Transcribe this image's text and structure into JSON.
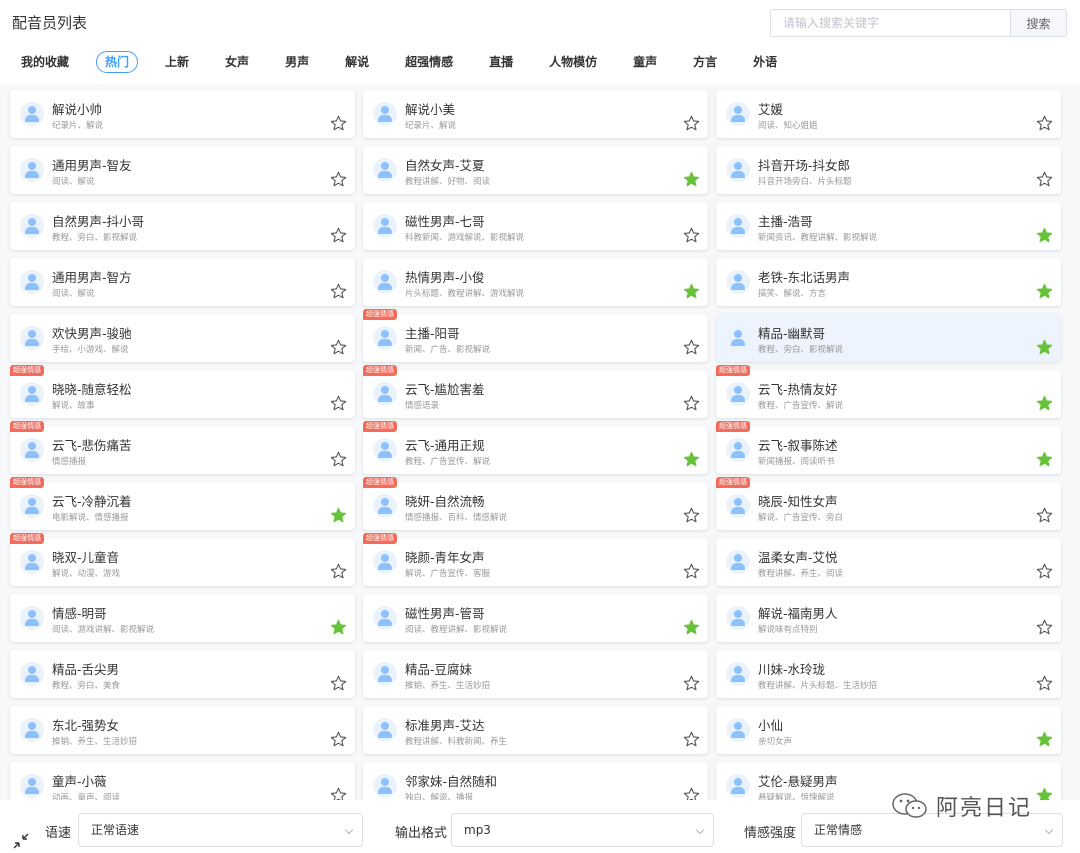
{
  "header": {
    "title": "配音员列表",
    "search_placeholder": "请输入搜索关键字",
    "search_button": "搜索"
  },
  "tabs": [
    {
      "label": "我的收藏",
      "active": false
    },
    {
      "label": "热门",
      "active": true
    },
    {
      "label": "上新",
      "active": false
    },
    {
      "label": "女声",
      "active": false
    },
    {
      "label": "男声",
      "active": false
    },
    {
      "label": "解说",
      "active": false
    },
    {
      "label": "超强情感",
      "active": false
    },
    {
      "label": "直播",
      "active": false
    },
    {
      "label": "人物模仿",
      "active": false
    },
    {
      "label": "童声",
      "active": false
    },
    {
      "label": "方言",
      "active": false
    },
    {
      "label": "外语",
      "active": false
    }
  ],
  "badge_text": "超强情感",
  "voices": [
    {
      "name": "解说小帅",
      "tags": "纪录片、解说",
      "favorite": false,
      "badge": false
    },
    {
      "name": "解说小美",
      "tags": "纪录片、解说",
      "favorite": false,
      "badge": false
    },
    {
      "name": "艾媛",
      "tags": "阅读、知心姐姐",
      "favorite": false,
      "badge": false
    },
    {
      "name": "通用男声-智友",
      "tags": "阅读、解说",
      "favorite": false,
      "badge": false
    },
    {
      "name": "自然女声-艾夏",
      "tags": "教程讲解、好物、阅读",
      "favorite": true,
      "badge": false
    },
    {
      "name": "抖音开场-抖女郎",
      "tags": "抖音开场旁白、片头标题",
      "favorite": false,
      "badge": false
    },
    {
      "name": "自然男声-抖小哥",
      "tags": "教程、旁白、影视解说",
      "favorite": false,
      "badge": false
    },
    {
      "name": "磁性男声-七哥",
      "tags": "科教新闻、游戏解说、影视解说",
      "favorite": false,
      "badge": false
    },
    {
      "name": "主播-浩哥",
      "tags": "新闻资讯、教程讲解、影视解说",
      "favorite": true,
      "badge": false
    },
    {
      "name": "通用男声-智方",
      "tags": "阅读、解说",
      "favorite": false,
      "badge": false
    },
    {
      "name": "热情男声-小俊",
      "tags": "片头标题、教程讲解、游戏解说",
      "favorite": true,
      "badge": false
    },
    {
      "name": "老铁-东北话男声",
      "tags": "搞笑、解说、方言",
      "favorite": true,
      "badge": false
    },
    {
      "name": "欢快男声-骏驰",
      "tags": "手绘、小游戏、解说",
      "favorite": false,
      "badge": false
    },
    {
      "name": "主播-阳哥",
      "tags": "新闻、广告、影视解说",
      "favorite": false,
      "badge": true
    },
    {
      "name": "精品-幽默哥",
      "tags": "教程、旁白、影视解说",
      "favorite": true,
      "badge": false,
      "selected": true
    },
    {
      "name": "晓晓-随意轻松",
      "tags": "解说、故事",
      "favorite": false,
      "badge": true
    },
    {
      "name": "云飞-尴尬害羞",
      "tags": "情感语录",
      "favorite": false,
      "badge": true
    },
    {
      "name": "云飞-热情友好",
      "tags": "教程、广告宣传、解说",
      "favorite": true,
      "badge": true
    },
    {
      "name": "云飞-悲伤痛苦",
      "tags": "情感播报",
      "favorite": false,
      "badge": true
    },
    {
      "name": "云飞-通用正规",
      "tags": "教程、广告宣传、解说",
      "favorite": true,
      "badge": true
    },
    {
      "name": "云飞-叙事陈述",
      "tags": "新闻播报、阅读听书",
      "favorite": true,
      "badge": true
    },
    {
      "name": "云飞-冷静沉着",
      "tags": "电影解说、情感播报",
      "favorite": true,
      "badge": true
    },
    {
      "name": "晓妍-自然流畅",
      "tags": "情感播报、百科、情感解说",
      "favorite": false,
      "badge": true
    },
    {
      "name": "晓辰-知性女声",
      "tags": "解说、广告宣传、旁白",
      "favorite": false,
      "badge": true
    },
    {
      "name": "晓双-儿童音",
      "tags": "解说、动漫、游戏",
      "favorite": false,
      "badge": true
    },
    {
      "name": "晓颜-青年女声",
      "tags": "解说、广告宣传、客服",
      "favorite": false,
      "badge": true
    },
    {
      "name": "温柔女声-艾悦",
      "tags": "教程讲解、养生、阅读",
      "favorite": false,
      "badge": false
    },
    {
      "name": "情感-明哥",
      "tags": "阅读、游戏讲解、影视解说",
      "favorite": true,
      "badge": false
    },
    {
      "name": "磁性男声-管哥",
      "tags": "阅读、教程讲解、影视解说",
      "favorite": true,
      "badge": false
    },
    {
      "name": "解说-福南男人",
      "tags": "解说味有点特别",
      "favorite": false,
      "badge": false
    },
    {
      "name": "精品-舌尖男",
      "tags": "教程、旁白、美食",
      "favorite": false,
      "badge": false
    },
    {
      "name": "精品-豆腐妹",
      "tags": "推销、养生、生活妙招",
      "favorite": false,
      "badge": false
    },
    {
      "name": "川妹-水玲珑",
      "tags": "教程讲解、片头标题、生活妙招",
      "favorite": false,
      "badge": false
    },
    {
      "name": "东北-强势女",
      "tags": "推销、养生、生活妙招",
      "favorite": false,
      "badge": false
    },
    {
      "name": "标准男声-艾达",
      "tags": "教程讲解、科教新闻、养生",
      "favorite": false,
      "badge": false
    },
    {
      "name": "小仙",
      "tags": "亲切女声",
      "favorite": true,
      "badge": false
    },
    {
      "name": "童声-小薇",
      "tags": "动画、童声、阅读",
      "favorite": false,
      "badge": false
    },
    {
      "name": "邻家妹-自然随和",
      "tags": "独白、解说、播报",
      "favorite": false,
      "badge": false
    },
    {
      "name": "艾伦-悬疑男声",
      "tags": "悬疑解说、惊悚解说",
      "favorite": true,
      "badge": false
    }
  ],
  "footer": {
    "speed_label": "语速",
    "speed_value": "正常语速",
    "format_label": "输出格式",
    "format_value": "mp3",
    "emotion_label": "情感强度",
    "emotion_value": "正常情感"
  },
  "watermark": "阿亮日记",
  "colors": {
    "accent": "#409eff",
    "favorite_star": "#67c23a",
    "badge": "#f26b5b",
    "selected_card": "#edf4fd"
  }
}
